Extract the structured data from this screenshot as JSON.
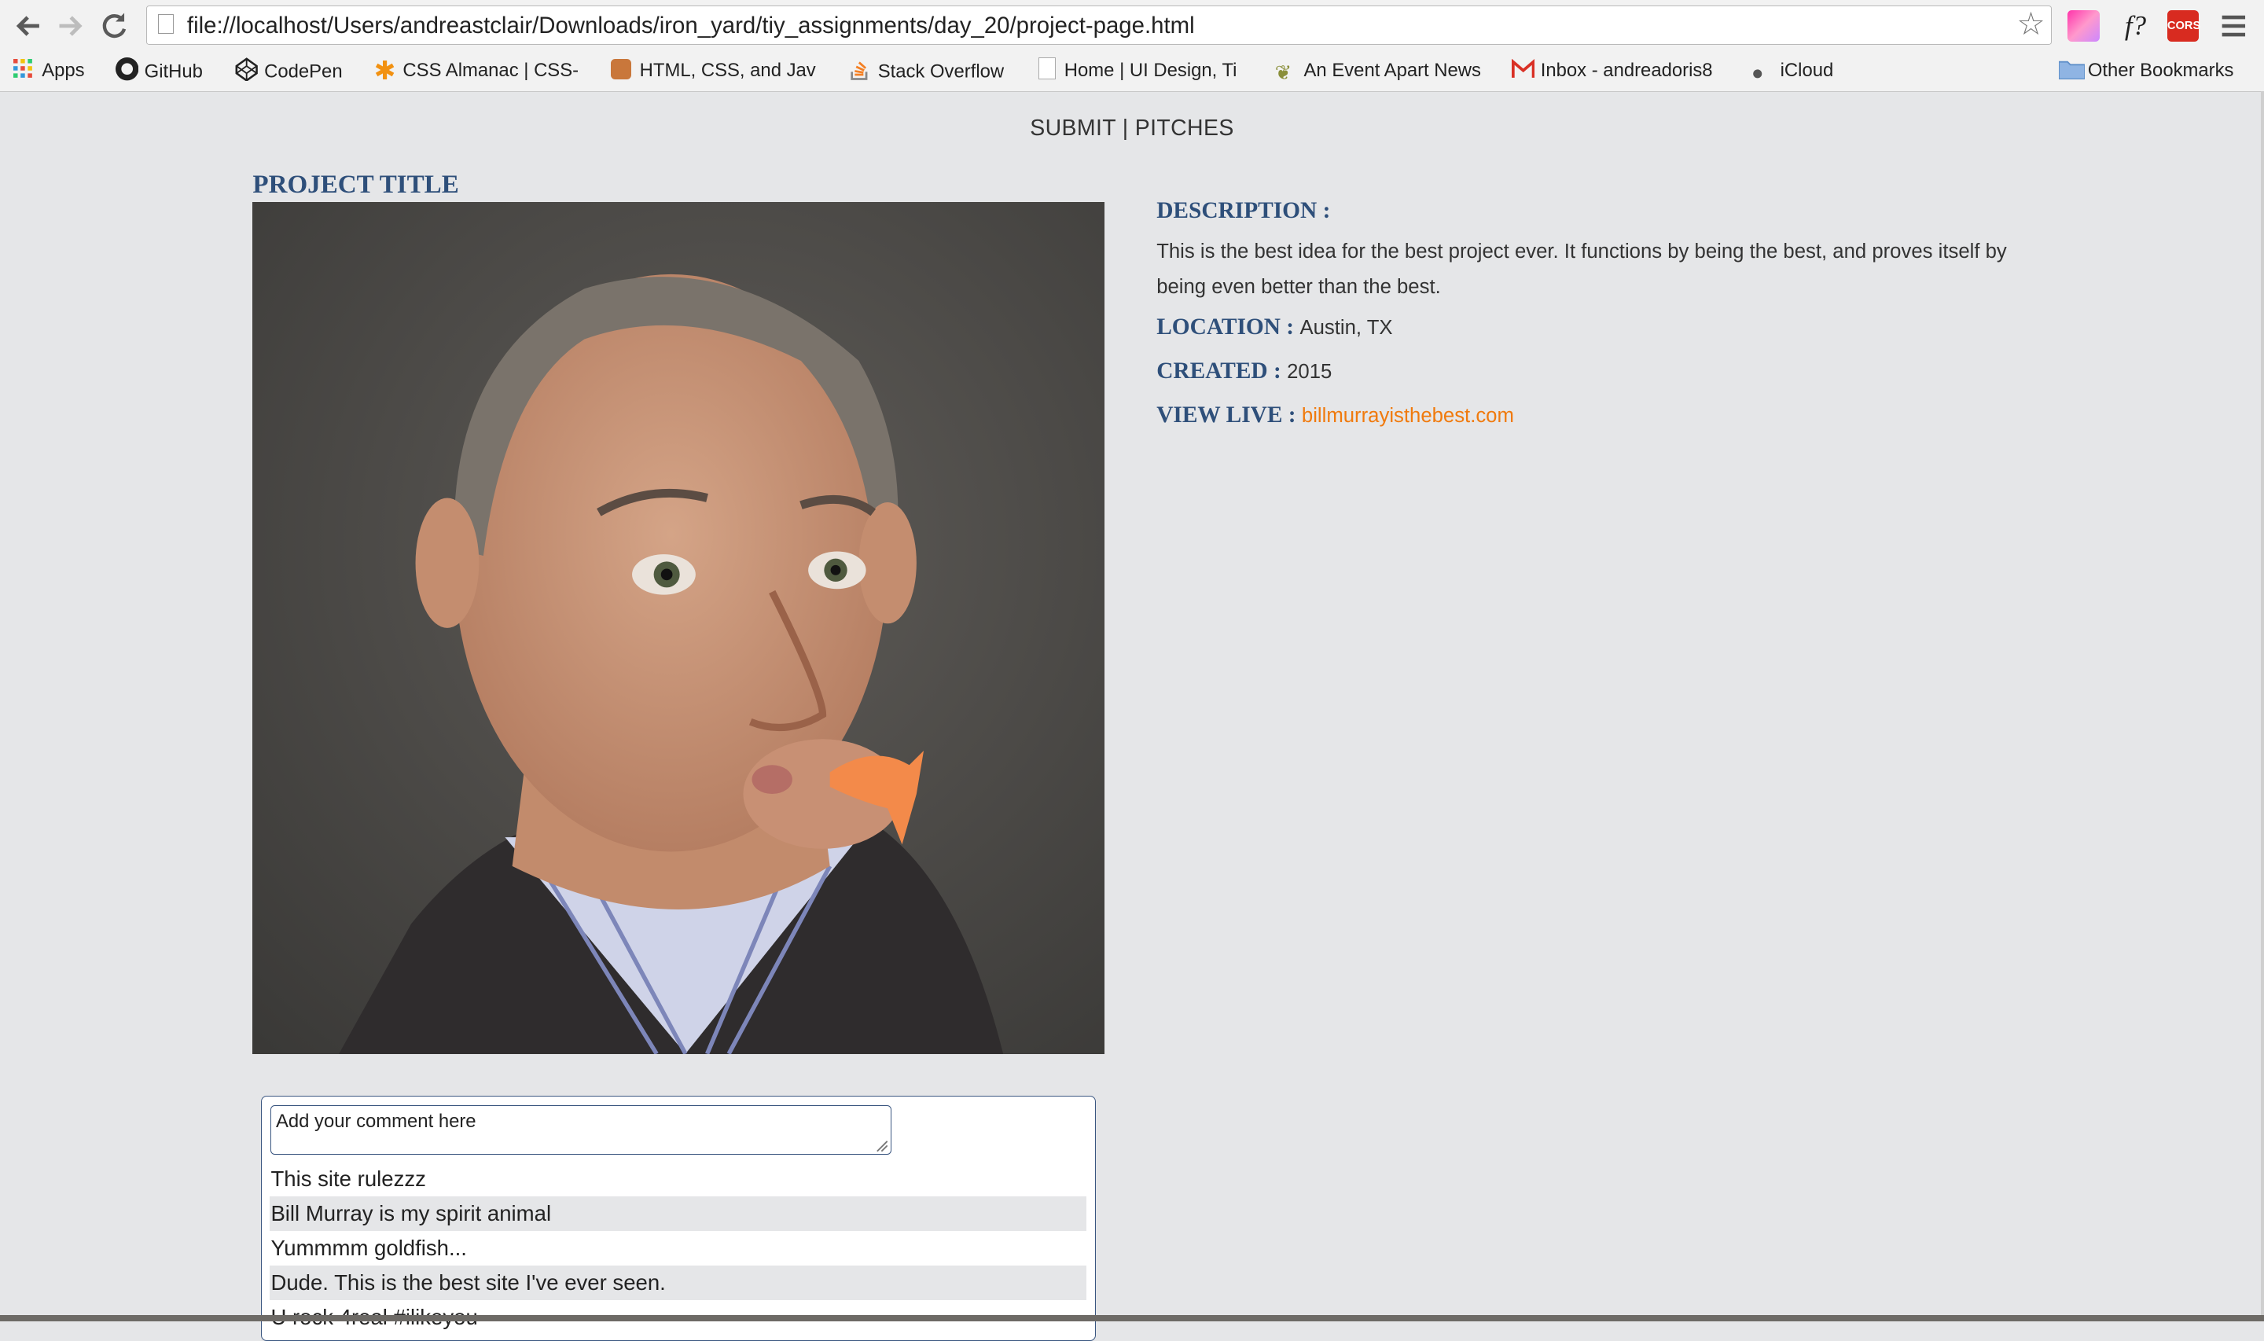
{
  "browser": {
    "url": "file://localhost/Users/andreastclair/Downloads/iron_yard/tiy_assignments/day_20/project-page.html",
    "extensions": [
      "paint-icon",
      "f?",
      "CORS"
    ],
    "bookmarks": [
      {
        "label": "Apps",
        "icon": "apps-grid-icon"
      },
      {
        "label": "GitHub",
        "icon": "github-icon"
      },
      {
        "label": "CodePen",
        "icon": "codepen-icon"
      },
      {
        "label": "CSS Almanac | CSS-",
        "icon": "asterisk-icon"
      },
      {
        "label": "HTML, CSS, and Jav",
        "icon": "fox-icon"
      },
      {
        "label": "Stack Overflow",
        "icon": "stackoverflow-icon"
      },
      {
        "label": "Home | UI Design, Ti",
        "icon": "page-icon"
      },
      {
        "label": "An Event Apart News",
        "icon": "leaf-icon"
      },
      {
        "label": "Inbox - andreadoris8",
        "icon": "gmail-icon"
      },
      {
        "label": "iCloud",
        "icon": "apple-icon"
      }
    ],
    "other_bookmarks": "Other Bookmarks"
  },
  "nav": {
    "submit": "SUBMIT",
    "separator": "|",
    "pitches": "PITCHES"
  },
  "project": {
    "title": "PROJECT TITLE",
    "description_label": "DESCRIPTION :",
    "description": "This is the best idea for the best project ever. It functions by being the best, and proves itself by being even better than the best.",
    "location_label": "LOCATION :",
    "location": "Austin, TX",
    "created_label": "CREATED :",
    "created": "2015",
    "view_live_label": "VIEW LIVE :",
    "view_live_link": "billmurrayisthebest.com"
  },
  "comments": {
    "placeholder": "Add your comment here",
    "items": [
      "This site rulezzz",
      "Bill Murray is my spirit animal",
      "Yummmm goldfish...",
      "Dude. This is the best site I've ever seen.",
      "U rock 4real #ilikeyou"
    ]
  }
}
